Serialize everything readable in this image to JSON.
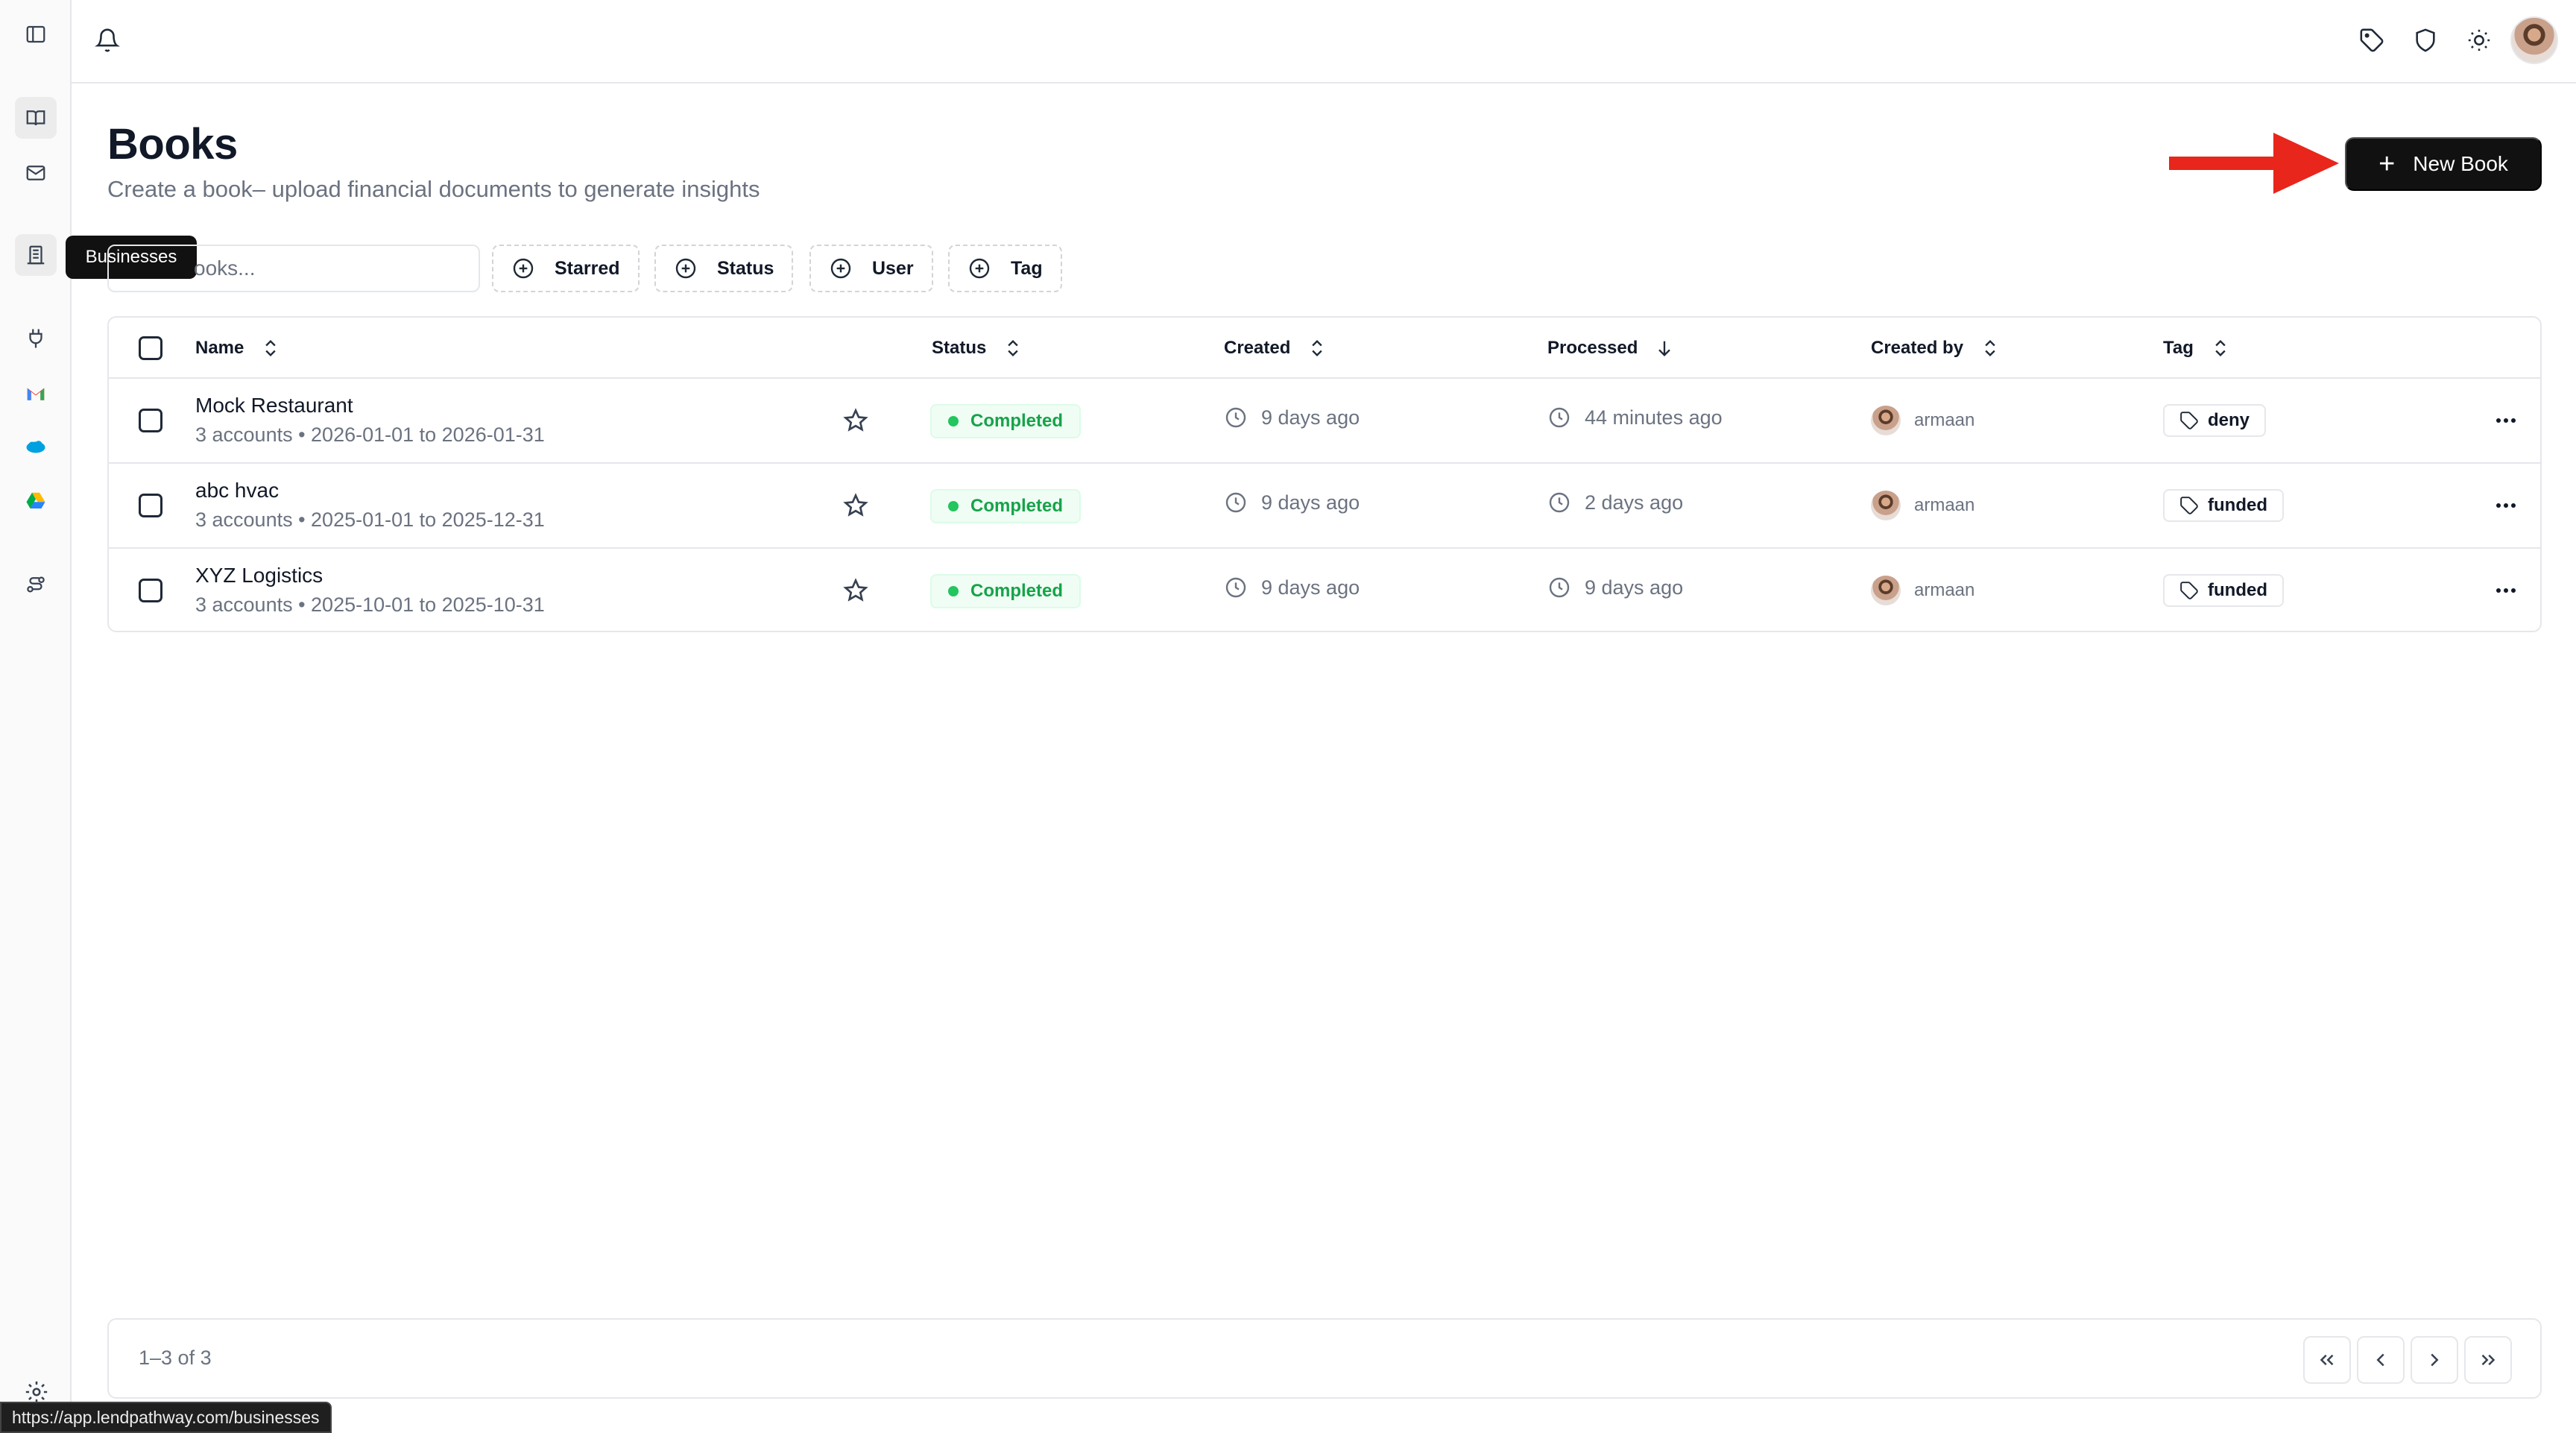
{
  "sidebar": {
    "tooltip": "Businesses",
    "items": [
      {
        "icon": "sidebar-toggle-icon"
      },
      {
        "icon": "book-icon",
        "active": true
      },
      {
        "icon": "mail-icon"
      },
      {
        "icon": "building-icon",
        "label": "Businesses"
      },
      {
        "icon": "plug-icon"
      },
      {
        "icon": "gmail-icon"
      },
      {
        "icon": "salesforce-icon"
      },
      {
        "icon": "google-drive-icon"
      },
      {
        "icon": "route-icon"
      },
      {
        "icon": "settings-icon"
      }
    ]
  },
  "topbar": {
    "icons": [
      "bell-icon",
      "tag-icon",
      "shield-icon",
      "sun-icon",
      "avatar"
    ]
  },
  "header": {
    "title": "Books",
    "subtitle": "Create a book– upload financial documents to generate insights",
    "new_book_label": "New Book"
  },
  "filters": {
    "search_placeholder": "Search books...",
    "search_visible_text": "ooks...",
    "chips": [
      "Starred",
      "Status",
      "User",
      "Tag"
    ]
  },
  "table": {
    "columns": [
      "Name",
      "Status",
      "Created",
      "Processed",
      "Created by",
      "Tag"
    ],
    "rows": [
      {
        "name": "Mock Restaurant",
        "meta": "3 accounts • 2026-01-01 to 2026-01-31",
        "status": "Completed",
        "created": "9 days ago",
        "processed": "44 minutes ago",
        "created_by": "armaan",
        "tag": "deny"
      },
      {
        "name": "abc hvac",
        "meta": "3 accounts • 2025-01-01 to 2025-12-31",
        "status": "Completed",
        "created": "9 days ago",
        "processed": "2 days ago",
        "created_by": "armaan",
        "tag": "funded"
      },
      {
        "name": "XYZ Logistics",
        "meta": "3 accounts • 2025-10-01 to 2025-10-31",
        "status": "Completed",
        "created": "9 days ago",
        "processed": "9 days ago",
        "created_by": "armaan",
        "tag": "funded"
      }
    ]
  },
  "footer": {
    "count": "1–3 of 3"
  },
  "statusbar": {
    "url": "https://app.lendpathway.com/businesses"
  },
  "colors": {
    "primary_button": "#111111",
    "status_green": "#16a34a",
    "annotation_arrow": "#e8261c"
  }
}
